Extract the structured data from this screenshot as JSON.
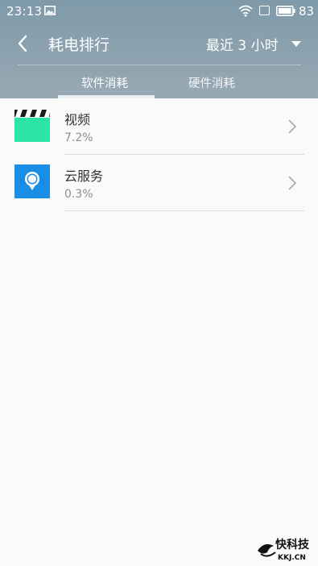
{
  "status_bar": {
    "time": "23:13",
    "battery_level": "83",
    "icons": [
      "image-icon",
      "wifi-icon",
      "square-icon",
      "battery-icon"
    ]
  },
  "header": {
    "title": "耗电排行",
    "time_range": "最近 3 小时",
    "tabs": [
      {
        "label": "软件消耗",
        "active": true
      },
      {
        "label": "硬件消耗",
        "active": false
      }
    ]
  },
  "apps": [
    {
      "name": "视频",
      "percent": "7.2%",
      "icon": "video-app-icon",
      "color": "#2ee3a6"
    },
    {
      "name": "云服务",
      "percent": "0.3%",
      "icon": "cloud-service-app-icon",
      "color": "#1a8ee6"
    }
  ],
  "watermark": {
    "brand": "快科技",
    "domain": "KKJ.CN"
  },
  "colors": {
    "header": "#8aa1ae",
    "background": "#fafafa"
  }
}
